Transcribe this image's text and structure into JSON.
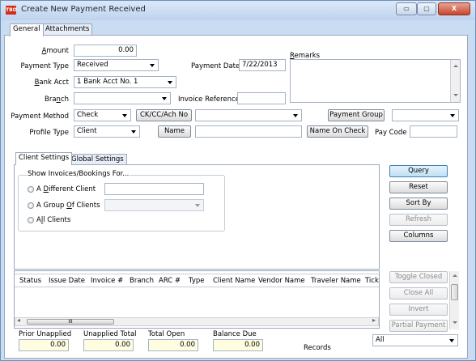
{
  "window": {
    "title": "Create New Payment Received",
    "icon_text": "TBO",
    "minimize": "▭",
    "maximize": "▢",
    "close": "X"
  },
  "tabs": {
    "general": "General",
    "attachments": "Attachments"
  },
  "form": {
    "amount_label": "Amount",
    "amount_value": "0.00",
    "payment_type_label": "Payment Type",
    "payment_type_value": "Received",
    "payment_date_label": "Payment Date",
    "payment_date_value": "7/22/2013",
    "remarks_label": "Remarks",
    "bank_acct_label": "Bank Acct",
    "bank_acct_value": "1 Bank Acct No. 1",
    "branch_label": "Branch",
    "branch_value": "",
    "invoice_reference_label": "Invoice Reference",
    "invoice_reference_value": "",
    "payment_method_label": "Payment Method",
    "payment_method_value": "Check",
    "cc_ach_button": "CK/CC/Ach No",
    "cc_ach_value": "",
    "payment_group_button": "Payment Group",
    "payment_group_value": "",
    "profile_type_label": "Profile Type",
    "profile_type_value": "Client",
    "name_button": "Name",
    "name_value": "",
    "name_on_check_button": "Name On Check",
    "pay_code_label": "Pay Code",
    "pay_code_value": ""
  },
  "settings_tabs": {
    "client": "Client Settings",
    "global": "Global Settings"
  },
  "show_invoices": {
    "group_label": "Show Invoices/Bookings For...",
    "different_client": "A Different Client",
    "group_of_clients": "A Group Of Clients",
    "all_clients": "All Clients"
  },
  "actions": {
    "query": "Query",
    "reset": "Reset",
    "sort_by": "Sort By",
    "refresh": "Refresh",
    "columns": "Columns",
    "toggle_closed": "Toggle Closed",
    "close_all": "Close All",
    "invert": "Invert",
    "partial_payment": "Partial Payment"
  },
  "grid": {
    "columns": [
      "Status",
      "Issue Date",
      "Invoice #",
      "Branch",
      "ARC #",
      "Type",
      "Client Name",
      "Vendor Name",
      "Traveler Name",
      "Tick"
    ],
    "hscroll_grip": "III"
  },
  "totals": {
    "prior_unapplied_label": "Prior Unapplied",
    "prior_unapplied_value": "0.00",
    "unapplied_total_label": "Unapplied Total",
    "unapplied_total_value": "0.00",
    "total_open_label": "Total Open",
    "total_open_value": "0.00",
    "balance_due_label": "Balance Due",
    "balance_due_value": "0.00",
    "records_label": "Records",
    "records_value": "All"
  }
}
